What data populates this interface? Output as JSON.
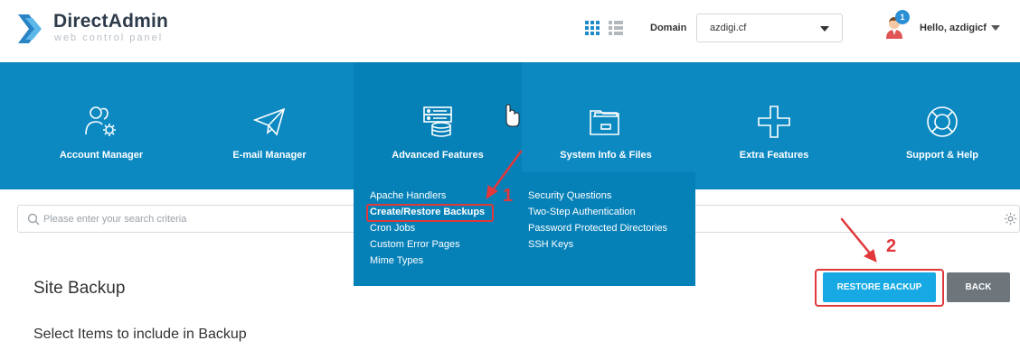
{
  "brand": {
    "name": "DirectAdmin",
    "tagline": "web control panel"
  },
  "header": {
    "domain_label": "Domain",
    "domain_value": "azdigi.cf",
    "notification_count": "1",
    "greeting": "Hello, azdigicf"
  },
  "nav": {
    "items": [
      {
        "label": "Account Manager",
        "icon": "users-gear-icon"
      },
      {
        "label": "E-mail Manager",
        "icon": "paper-plane-icon"
      },
      {
        "label": "Advanced Features",
        "icon": "server-database-icon"
      },
      {
        "label": "System Info & Files",
        "icon": "folder-icon"
      },
      {
        "label": "Extra Features",
        "icon": "plus-icon"
      },
      {
        "label": "Support & Help",
        "icon": "life-ring-icon"
      }
    ]
  },
  "dropdown": {
    "col1": [
      "Apache Handlers",
      "Create/Restore Backups",
      "Cron Jobs",
      "Custom Error Pages",
      "Mime Types"
    ],
    "col2": [
      "Security Questions",
      "Two-Step Authentication",
      "Password Protected Directories",
      "SSH Keys"
    ]
  },
  "search": {
    "placeholder": "Please enter your search criteria"
  },
  "page": {
    "title": "Site Backup",
    "section_title": "Select Items to include in Backup",
    "restore_button": "RESTORE BACKUP",
    "back_button": "BACK"
  },
  "annotations": {
    "step1": "1",
    "step2": "2"
  },
  "colors": {
    "nav_bg": "#0d89c2",
    "accent": "#16a9e3",
    "highlight": "#e0383b"
  }
}
